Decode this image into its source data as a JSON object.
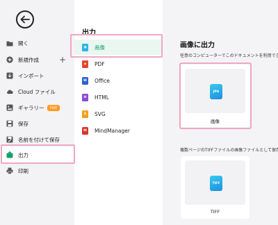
{
  "sidebar": {
    "items": [
      {
        "label": "開く",
        "icon": "folder-icon"
      },
      {
        "label": "新規作成",
        "icon": "plus-circle-icon"
      },
      {
        "label": "インポート",
        "icon": "import-icon"
      },
      {
        "label": "Cloud ファイル",
        "icon": "cloud-icon"
      },
      {
        "label": "ギャラリー",
        "icon": "gallery-icon",
        "badge": "Hot"
      },
      {
        "label": "保存",
        "icon": "save-icon"
      },
      {
        "label": "名前を付けて保存",
        "icon": "save-as-icon"
      },
      {
        "label": "出力",
        "icon": "export-icon"
      },
      {
        "label": "印刷",
        "icon": "print-icon"
      }
    ],
    "new_plus": "+"
  },
  "middle": {
    "title": "出力",
    "items": [
      {
        "label": "画像",
        "color": "#2bb4ea",
        "tag": "JPG"
      },
      {
        "label": "PDF",
        "color": "#e5452f",
        "tag": "PDF"
      },
      {
        "label": "Office",
        "color": "#2a62c9",
        "tag": "W"
      },
      {
        "label": "HTML",
        "color": "#8c4cd6",
        "tag": "H"
      },
      {
        "label": "SVG",
        "color": "#f0a020",
        "tag": "S"
      },
      {
        "label": "MindManager",
        "color": "#d8362b",
        "tag": "M"
      }
    ]
  },
  "right": {
    "title": "画像に出力",
    "desc1": "任意のコンピューターでこのドキュメントを利用できる",
    "desc2": "複数ページのTIFFファイルの画像ファイルとして保存し",
    "cards": [
      {
        "label": "画像",
        "tag": "JPG"
      },
      {
        "label": "TIFF",
        "tag": "TIFF"
      }
    ]
  },
  "colors": {
    "accent": "#16a06a",
    "highlight": "#f0a6c4",
    "hot_badge": "#ff9a1f"
  }
}
